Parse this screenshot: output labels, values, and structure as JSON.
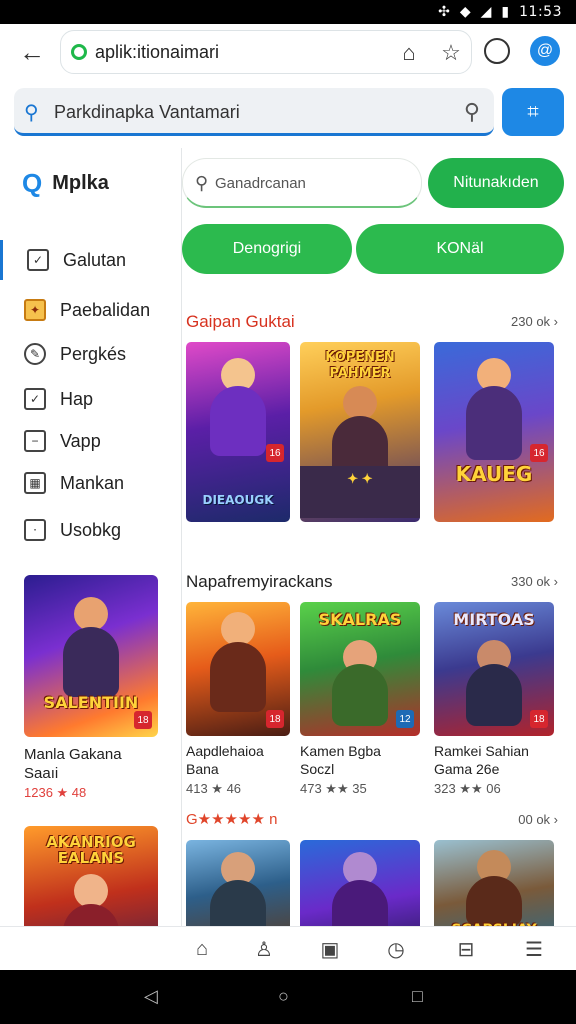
{
  "status": {
    "time": "11:53",
    "icons": [
      "nfc-icon",
      "wifi-icon",
      "signal-icon",
      "battery-icon"
    ]
  },
  "browser": {
    "url": "aplik:itionaimari",
    "profile_initial": "@",
    "search": {
      "value": "Parkdinapka Vantamari",
      "scan_label": "⌗"
    }
  },
  "sidebar": {
    "brand": "Mplka",
    "items": [
      {
        "label": "Galutan",
        "icon": "checkbox-icon"
      },
      {
        "label": "Paebalidan",
        "icon": "game-icon"
      },
      {
        "label": "Pergkés",
        "icon": "edit-icon"
      },
      {
        "label": "Hap",
        "icon": "check-icon"
      },
      {
        "label": "Vapp",
        "icon": "download-icon"
      },
      {
        "label": "Mankan",
        "icon": "calendar-icon"
      },
      {
        "label": "Usobkg",
        "icon": "lock-icon"
      }
    ],
    "cards": [
      {
        "title": "Manla Gakana\nSaaıi",
        "rating": "1236 ★ 48",
        "logo": "SALENTIIN",
        "colors": [
          "#3b1b8f",
          "#ff6a2b"
        ]
      },
      {
        "title": "",
        "rating": "",
        "logo": "AKANRIOG EALANS",
        "colors": [
          "#c0301c",
          "#2a1a52"
        ]
      }
    ]
  },
  "main": {
    "search_placeholder": "Ganadrcanan",
    "green_button": "Nitunakıden",
    "pills": [
      "Denogrigi",
      "KONäl"
    ],
    "sections": [
      {
        "title": "Gaipan Guktai",
        "more": "230 ok ›",
        "cards": [
          {
            "title": "",
            "rating": "",
            "logo": "DIEAOUGK",
            "colors": [
              "#5b1fa7",
              "#1d2a6a"
            ]
          },
          {
            "title": "",
            "rating": "",
            "logo": "KOPENEN PAHMER",
            "colors": [
              "#e39a2a",
              "#3a2a6e"
            ]
          },
          {
            "title": "",
            "rating": "",
            "logo": "KAUEG",
            "colors": [
              "#6a47c9",
              "#e26b1f"
            ]
          }
        ]
      },
      {
        "title": "Napafremyirackans",
        "more": "330 ok ›",
        "cards": [
          {
            "title": "Aapdlehaioa\nBana",
            "rating": "413 ★ 46",
            "logo": "",
            "colors": [
              "#e65c1a",
              "#4a1d14"
            ]
          },
          {
            "title": "Kamen Bgba\nSoczl",
            "rating": "473 ★★ 35",
            "logo": "SKALRAS",
            "colors": [
              "#2f8b3a",
              "#b52d2a"
            ]
          },
          {
            "title": "Ramkei Sahian\nGama 26e",
            "rating": "323 ★★ 06",
            "logo": "MIRTOAS",
            "colors": [
              "#3b3a8f",
              "#b1232b"
            ]
          }
        ]
      },
      {
        "title": "G★★★★★ n",
        "more": "00 ok ›",
        "cards": [
          {
            "title": "",
            "rating": "",
            "logo": "",
            "colors": [
              "#2d5f8a",
              "#5a3a22"
            ]
          },
          {
            "title": "",
            "rating": "",
            "logo": "",
            "colors": [
              "#6a2ac9",
              "#2a6ad9"
            ]
          },
          {
            "title": "",
            "rating": "",
            "logo": "SCAPSLIAY",
            "colors": [
              "#7a5a3a",
              "#2a6a8a"
            ]
          }
        ]
      }
    ]
  },
  "bottom_nav": [
    "home-icon",
    "person-icon",
    "store-icon",
    "history-icon",
    "bag-icon",
    "menu-icon"
  ],
  "system_nav": {
    "back": "◁",
    "home": "○",
    "recent": "□"
  }
}
